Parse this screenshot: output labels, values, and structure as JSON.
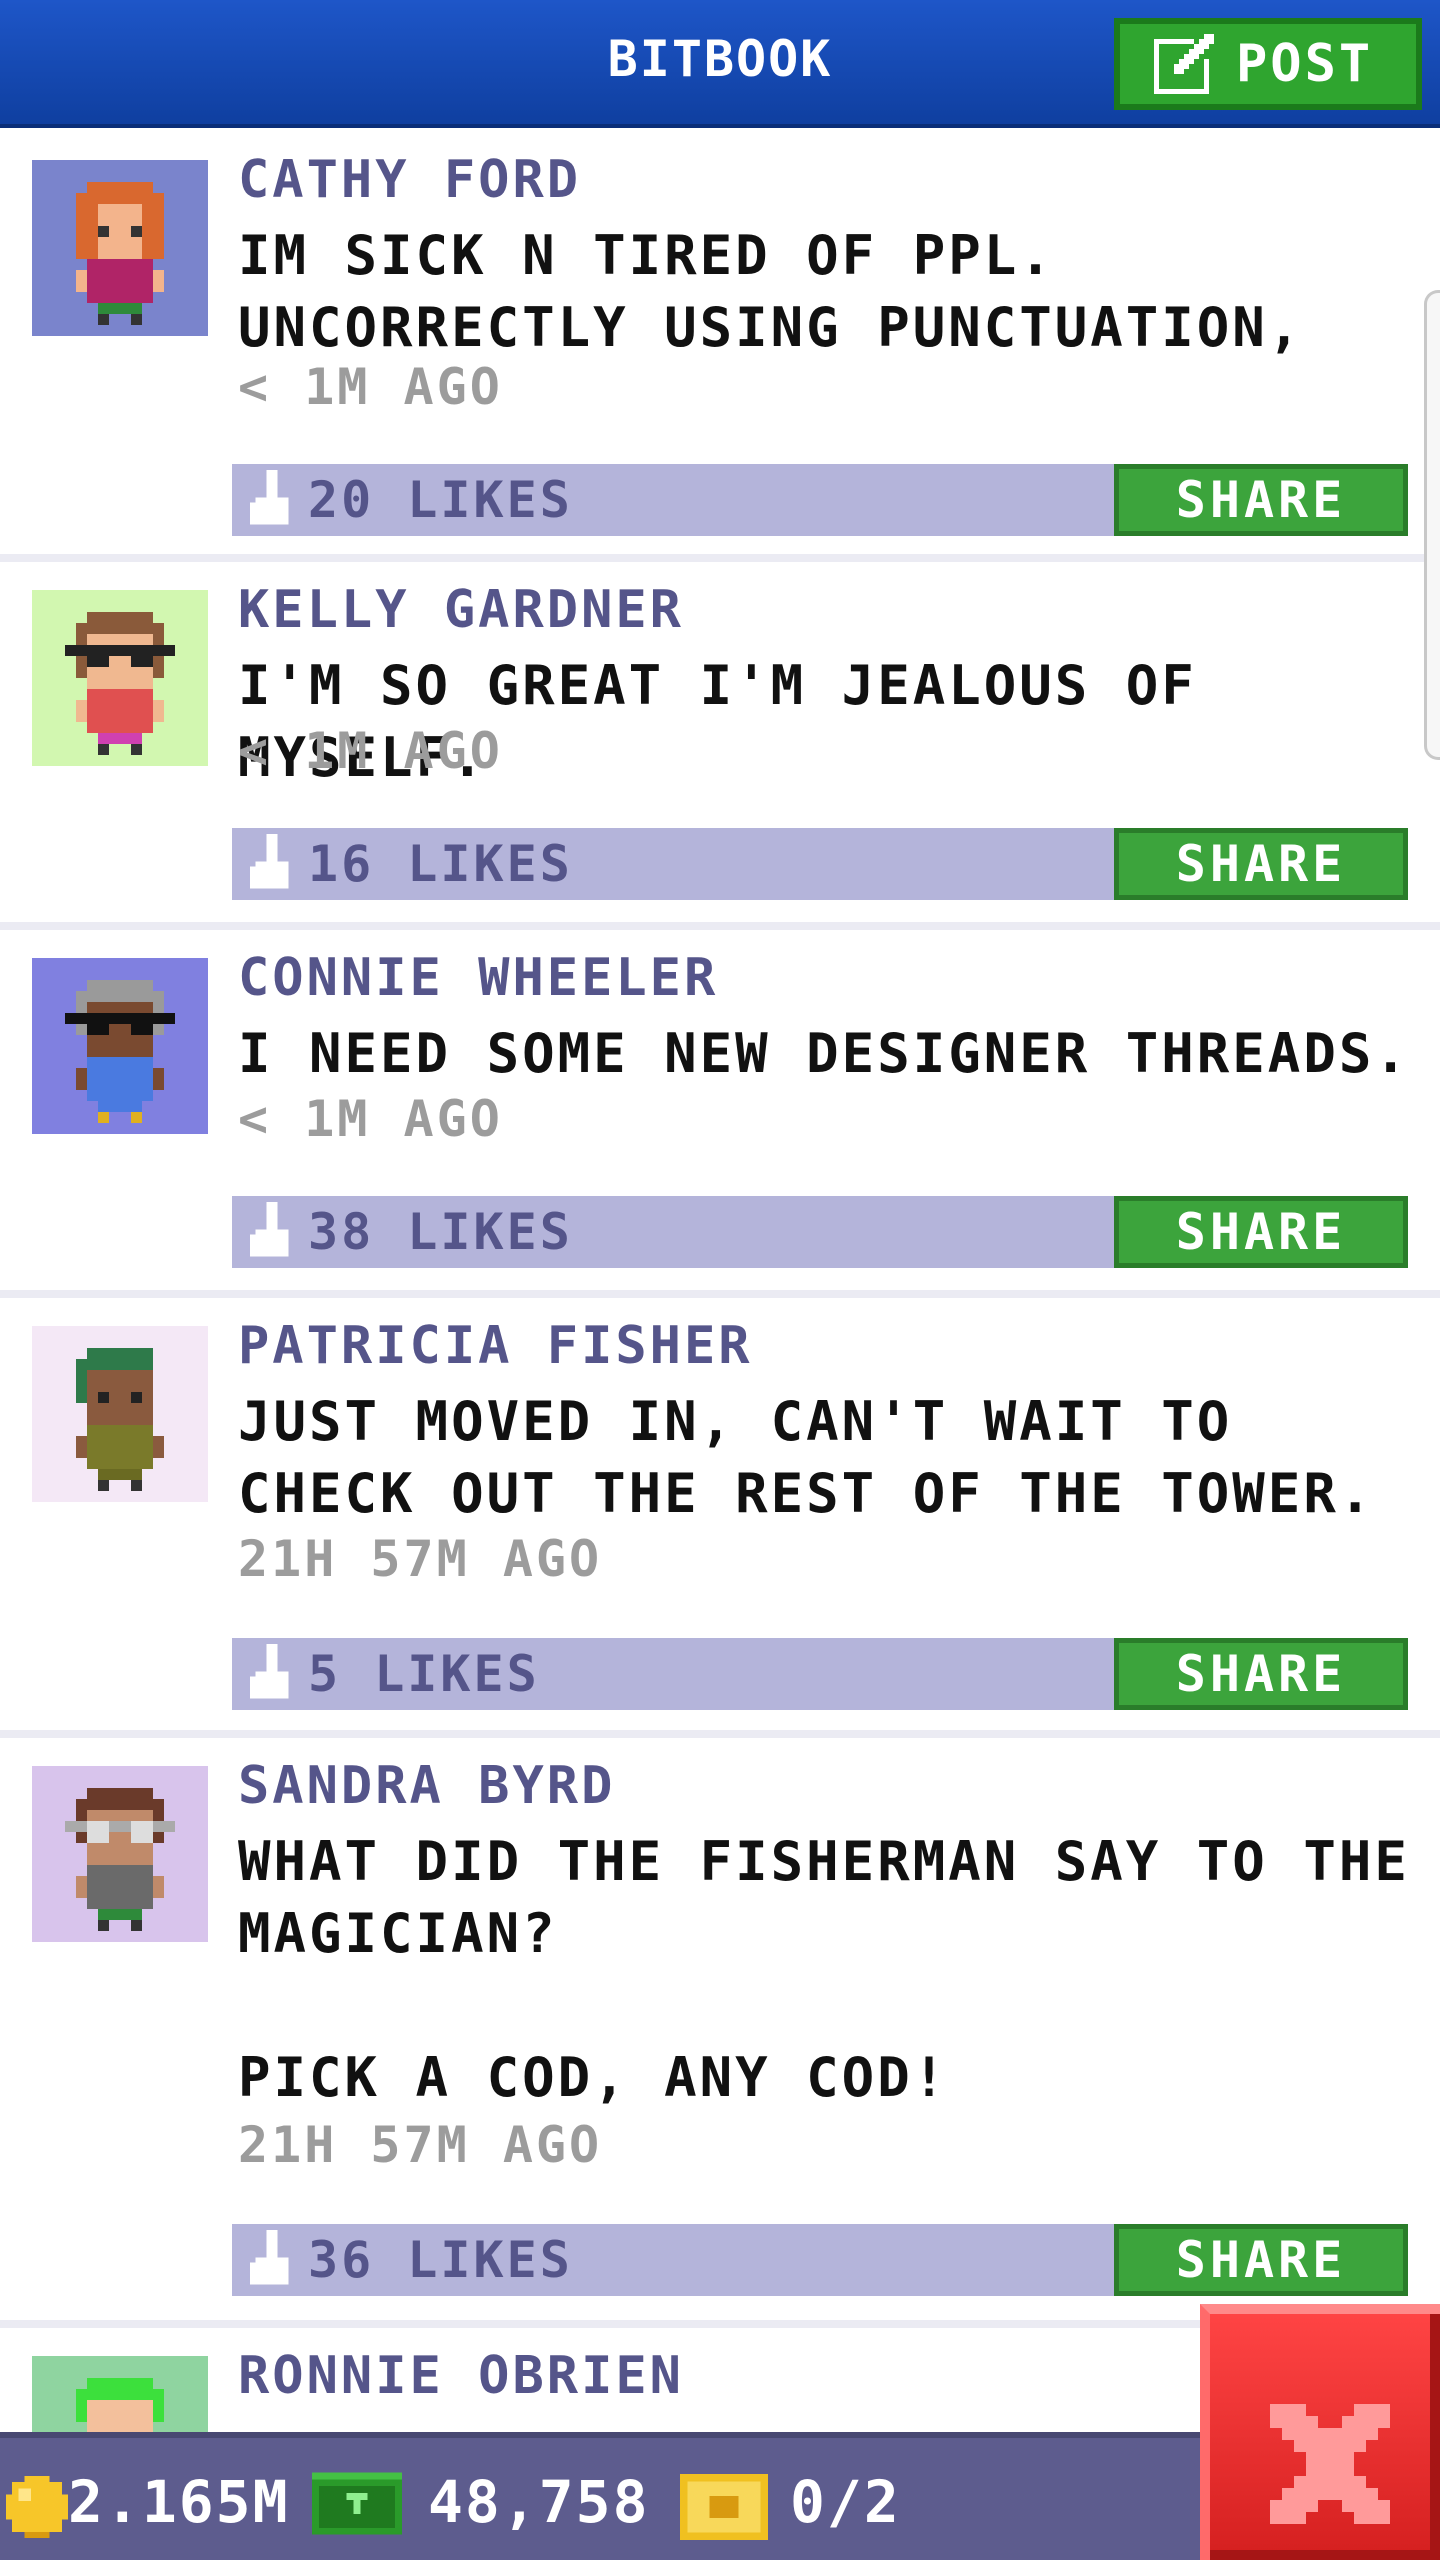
{
  "header": {
    "title": "BITBOOK",
    "post_label": "POST"
  },
  "posts": [
    {
      "author": "CATHY FORD",
      "message": "IM SICK N TIRED OF PPL. UNCORRECTLY USING PUNCTUATION,",
      "time": "< 1M AGO",
      "likes": "20 LIKES",
      "share": "SHARE",
      "avatar_bg": "#7a84cc"
    },
    {
      "author": "KELLY GARDNER",
      "message": "I'M SO GREAT I'M JEALOUS OF MYSELF.",
      "time": "< 1M AGO",
      "likes": "16 LIKES",
      "share": "SHARE",
      "avatar_bg": "#d2f7b0"
    },
    {
      "author": "CONNIE WHEELER",
      "message": "I NEED SOME NEW DESIGNER THREADS.",
      "time": "< 1M AGO",
      "likes": "38 LIKES",
      "share": "SHARE",
      "avatar_bg": "#8080e0"
    },
    {
      "author": "PATRICIA FISHER",
      "message": "JUST MOVED IN, CAN'T WAIT TO CHECK OUT THE REST OF THE TOWER.",
      "time": "21H 57M AGO",
      "likes": "5 LIKES",
      "share": "SHARE",
      "avatar_bg": "#f4e8f6"
    },
    {
      "author": "SANDRA BYRD",
      "message": "WHAT DID THE FISHERMAN SAY TO THE MAGICIAN?\n\nPICK A COD, ANY COD!",
      "time": "21H 57M AGO",
      "likes": "36 LIKES",
      "share": "SHARE",
      "avatar_bg": "#d8c4ec"
    },
    {
      "author": "RONNIE OBRIEN",
      "avatar_bg": "#8fd4a0"
    }
  ],
  "footer": {
    "coins": "2.165M",
    "bux": "48,758",
    "tickets": "0/2"
  },
  "icons": {
    "post": "edit-icon",
    "like": "thumbs-up-icon",
    "coin": "coin-icon",
    "bux": "bux-icon",
    "ticket": "ticket-icon",
    "close": "close-icon"
  },
  "colors": {
    "header": "#1e56c8",
    "post_button": "#2fa52f",
    "author": "#55558a",
    "like_bar": "#b4b4da",
    "share_button": "#3ca43c",
    "footer": "#5d5c8e",
    "close_button": "#e02a2a"
  }
}
